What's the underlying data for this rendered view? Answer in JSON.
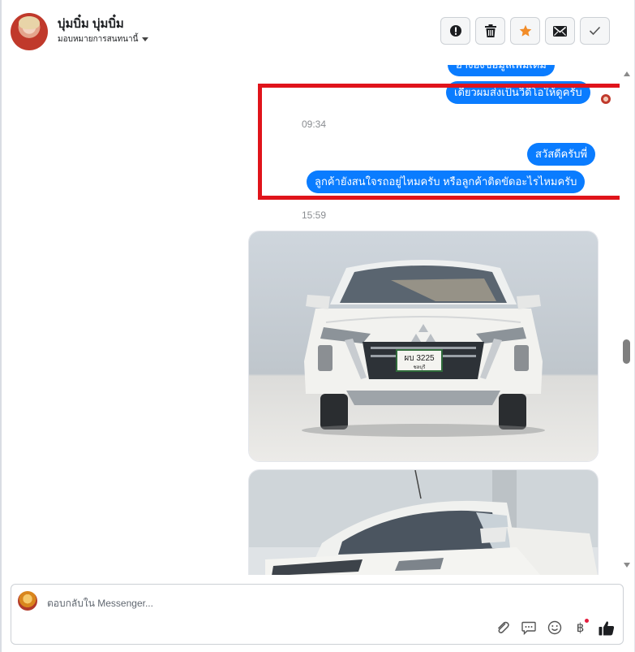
{
  "contact": {
    "name": "บุ่มบิ๋ม บุ่มบิ๋ม",
    "assign_label": "มอบหมายการสนทนานี้"
  },
  "header_actions": [
    {
      "icon": "alert-icon"
    },
    {
      "icon": "trash-icon"
    },
    {
      "icon": "star-icon"
    },
    {
      "icon": "mail-icon"
    },
    {
      "icon": "check-icon"
    }
  ],
  "messages": {
    "partial_top": "อ้างอิงข้อมูลเพิ่มเติม",
    "msg1": "เดี๋ยวผมส่งเป็นวิดีโอให้ดูครับ",
    "time1": "09:34",
    "msg2": "สวัสดีครับพี่",
    "msg3": "ลูกค้ายังสนใจรถอยู่ไหมครับ หรือลูกค้าติดขัดอะไรไหมครับ",
    "time2": "15:59"
  },
  "photos": [
    {
      "plate_line1": "ผบ 3225",
      "plate_line2": "ชลบุรี"
    },
    {}
  ],
  "composer": {
    "placeholder": "ตอบกลับใน Messenger..."
  },
  "colors": {
    "bubble": "#0a7cff",
    "highlight": "#e0141b",
    "star": "#f28c28"
  }
}
